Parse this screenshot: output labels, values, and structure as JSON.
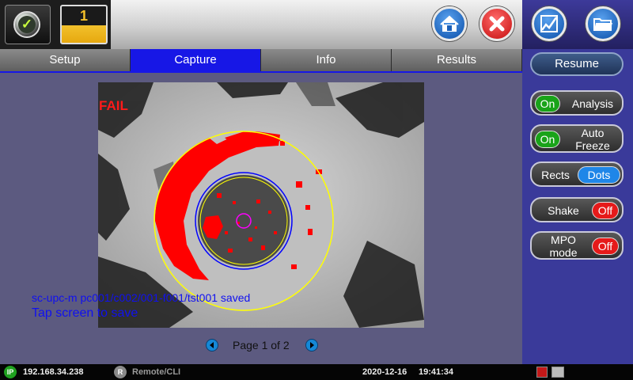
{
  "header": {
    "slot_number": "1",
    "home_icon": "home-icon",
    "close_icon": "close-icon"
  },
  "side_header": {
    "icon1": "signal-graph-icon",
    "icon2": "folder-icon"
  },
  "tabs": [
    {
      "label": "Setup"
    },
    {
      "label": "Capture"
    },
    {
      "label": "Info"
    },
    {
      "label": "Results"
    }
  ],
  "capture": {
    "fail_label": "FAIL",
    "saved_message": "sc-upc-m  pc001/c002/001-f001/tst001 saved",
    "tap_message": "Tap screen to save",
    "page_label": "Page 1 of 2"
  },
  "controls": {
    "resume_label": "Resume",
    "analysis": {
      "state": "On",
      "label": "Analysis"
    },
    "auto_freeze": {
      "state": "On",
      "label": "Auto Freeze",
      "line1": "Auto",
      "line2": "Freeze"
    },
    "view_mode": {
      "left": "Rects",
      "right": "Dots"
    },
    "shake": {
      "label": "Shake",
      "state": "Off"
    },
    "mpo_mode": {
      "label": "MPO mode",
      "line1": "MPO",
      "line2": "mode",
      "state": "Off"
    }
  },
  "status_bar": {
    "ip_badge": "IP",
    "ip_address": "192.168.34.238",
    "remote_badge": "R",
    "remote_label": "Remote/CLI",
    "date": "2020-12-16",
    "time": "19:41:34"
  },
  "colors": {
    "accent": "#1717e6",
    "fail": "#ff1a1a",
    "defect": "#ff0000",
    "zone_outer": "#ffff00",
    "zone_inner": "#0000ff",
    "core": "#ff00ff"
  }
}
